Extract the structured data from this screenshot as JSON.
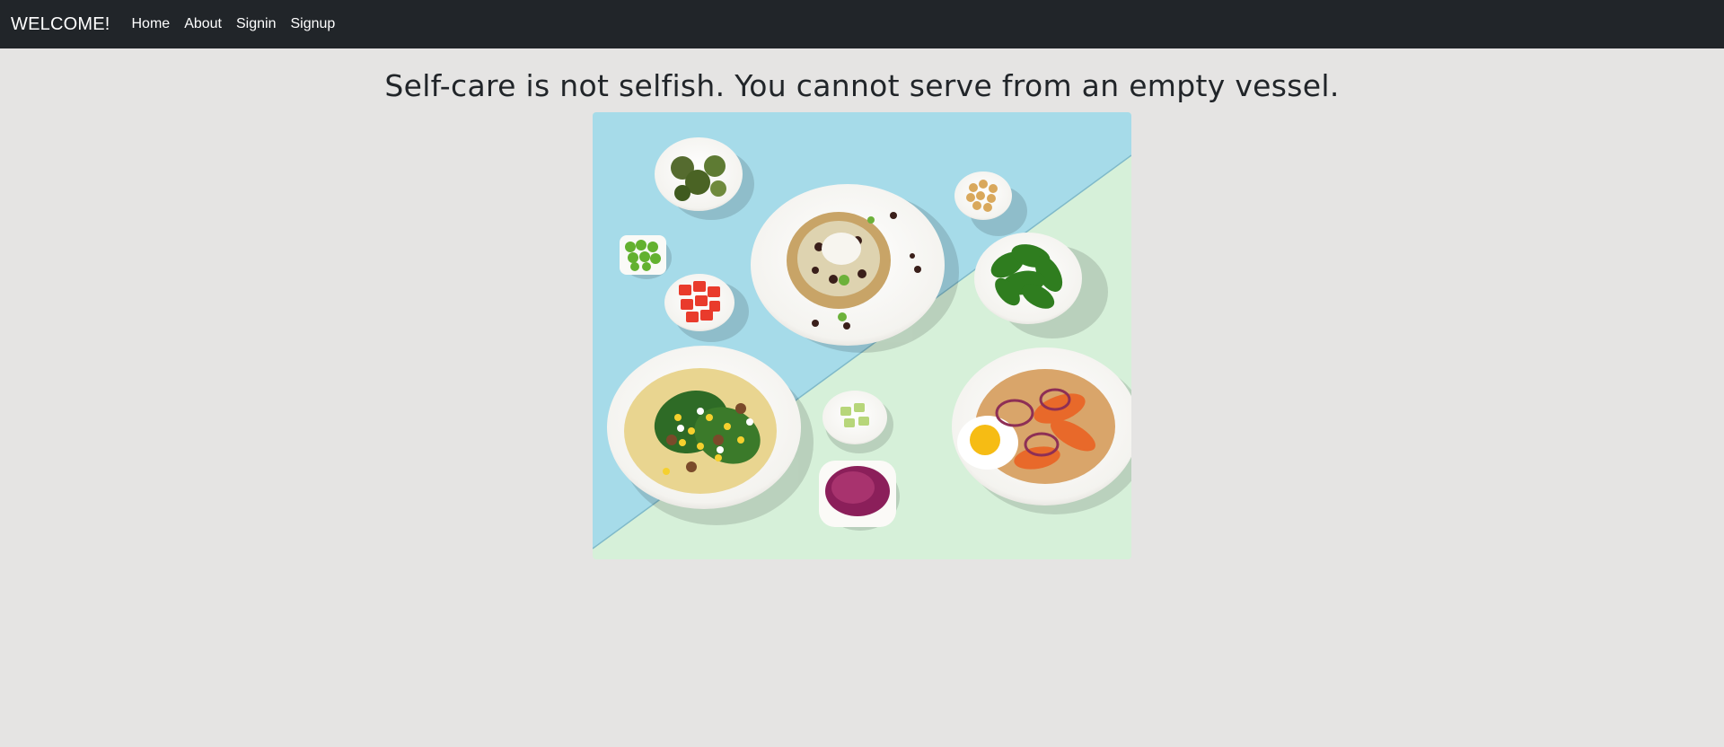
{
  "navbar": {
    "brand": "WELCOME!",
    "links": [
      {
        "label": "Home"
      },
      {
        "label": "About"
      },
      {
        "label": "Signin"
      },
      {
        "label": "Signup"
      }
    ],
    "background": "#212529"
  },
  "main": {
    "quote": "Self-care is not selfish. You cannot serve from an empty vessel.",
    "image": {
      "subject": "healthy-food-bowls-photo",
      "colors": {
        "sky_blue": "#a6dbe9",
        "mint_green": "#d8f1dc",
        "plate_white": "#f7f6f2"
      }
    }
  },
  "page": {
    "background": "#e5e4e3"
  }
}
